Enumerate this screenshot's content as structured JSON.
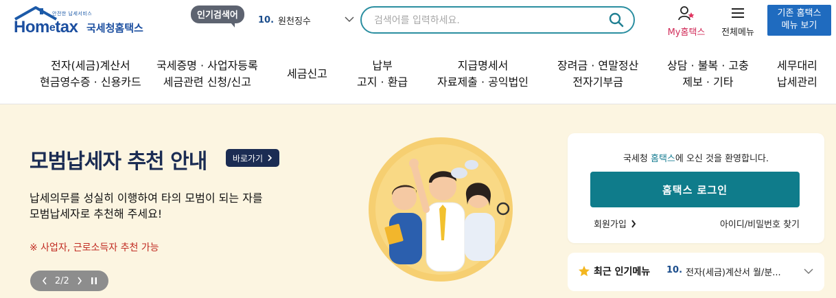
{
  "header": {
    "logo_small": "안전한 납세서비스",
    "logo_brand_home": "Hom",
    "logo_brand_e": "e",
    "logo_brand_tax": "tax",
    "logo_kor": "국세청홈택스",
    "popular_badge": "인기검색어",
    "popular_number": "10.",
    "popular_term": "원천징수",
    "search_placeholder": "검색어를 입력하세요.",
    "my_hometax": "My홈택스",
    "all_menu": "전체메뉴",
    "old_menu_line1": "기존 홈택스",
    "old_menu_line2": "메뉴 보기"
  },
  "nav": [
    {
      "line1": "전자(세금)계산서",
      "line2": "현금영수증 · 신용카드"
    },
    {
      "line1": "국세증명 · 사업자등록",
      "line2": "세금관련 신청/신고"
    },
    {
      "line1": "세금신고",
      "line2": ""
    },
    {
      "line1": "납부",
      "line2": "고지 · 환급"
    },
    {
      "line1": "지급명세서",
      "line2": "자료제출 · 공익법인"
    },
    {
      "line1": "장려금 · 연말정산",
      "line2": "전자기부금"
    },
    {
      "line1": "상담 · 불복 · 고충",
      "line2": "제보 · 기타"
    },
    {
      "line1": "세무대리",
      "line2": "납세관리"
    }
  ],
  "banner": {
    "title_a": "모범납세자",
    "title_b": " 추천 안내",
    "go_label": "바로가기",
    "desc_line1": "납세의무를 성실히 이행하여 타의 모범이 되는 자를",
    "desc_line2": "모범납세자로 추천해 주세요!",
    "note": "※ 사업자, 근로소득자 추천 가능",
    "pager_text": "2/2"
  },
  "login": {
    "welcome_prefix": "국세청 ",
    "welcome_highlight": "홈택스",
    "welcome_suffix": "에 오신 것을 환영합니다.",
    "login_button": "홈택스 로그인",
    "signup": "회원가입",
    "find_id": "아이디/비밀번호 찾기"
  },
  "recent": {
    "label": "최근 인기메뉴",
    "number": "10.",
    "text": "전자(세금)계산서 월/분..."
  },
  "colors": {
    "brand_blue": "#1c4fa0",
    "teal": "#0f7c8b",
    "banner_bg": "#fcf5e1",
    "navy": "#1b2c53",
    "note_red": "#c12b22",
    "my_red": "#d12d5a"
  },
  "icons": [
    "house-logo-icon",
    "chevron-down-icon",
    "search-icon",
    "user-icon",
    "hamburger-icon",
    "chevron-right-icon",
    "pause-icon",
    "star-icon"
  ]
}
